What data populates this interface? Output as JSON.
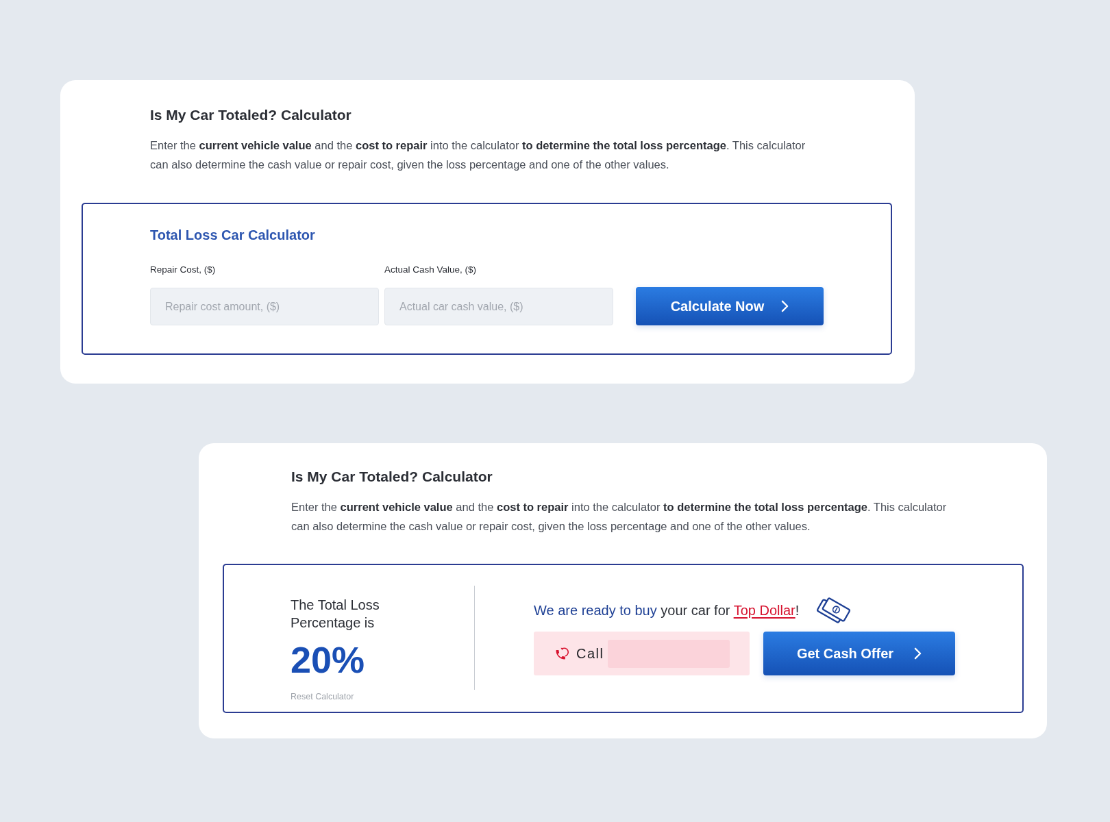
{
  "cards": [
    {
      "kind": "form",
      "heading": "Is My Car Totaled? Calculator",
      "intro": "Enter the **current vehicle value** and the **cost to repair** into the calculator **to determine the total loss percentage**. This calculator can also determine the cash value or repair cost, given the loss percentage and one of the other values.",
      "calculator": {
        "title": "Total Loss Car Calculator",
        "fields": [
          {
            "label": "Repair Cost, ($)",
            "placeholder": "Repair cost amount, ($)"
          },
          {
            "label": "Actual Cash Value, ($)",
            "placeholder": "Actual car cash value, ($)"
          }
        ],
        "button": "Calculate Now"
      }
    },
    {
      "kind": "result",
      "heading": "Is My Car Totaled? Calculator",
      "intro": "Enter the **current vehicle value** and the **cost to repair** into the calculator **to determine the total loss percentage**. This calculator can also determine the cash value or repair cost, given the loss percentage and one of the other values.",
      "result": {
        "label": "The Total Loss Percentage is",
        "value": "20%",
        "reset_link": "Reset Calculator",
        "offer": {
          "lead": "We are ready to buy",
          "middle": "your car for",
          "link": "Top Dollar",
          "tail": "!"
        },
        "call_button": "Call",
        "cash_button": "Get Cash Offer"
      }
    }
  ]
}
